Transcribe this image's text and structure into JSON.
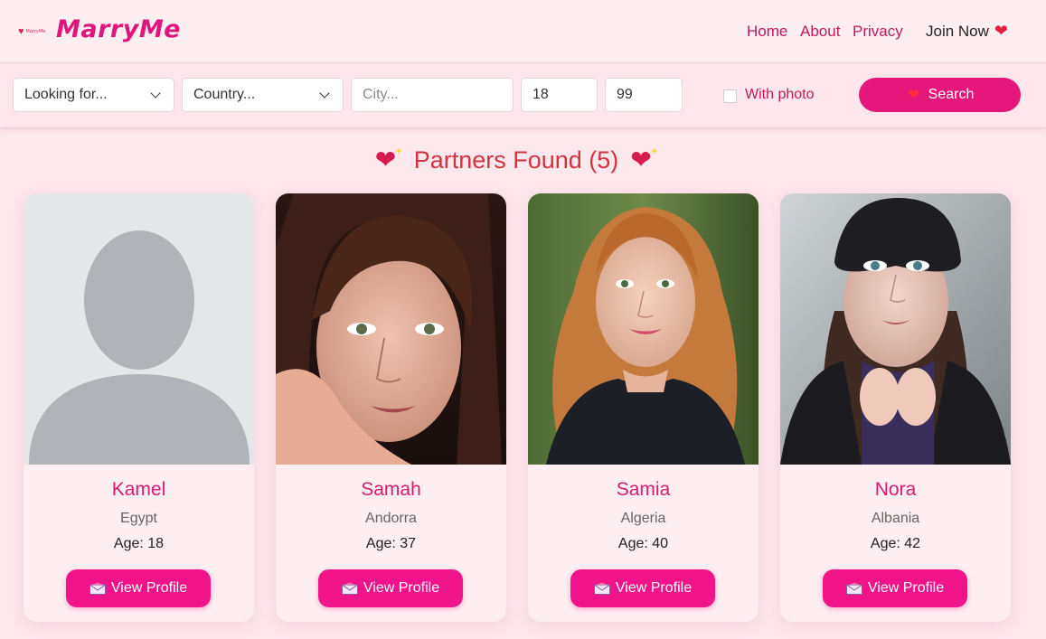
{
  "brand": {
    "name": "MarryMe",
    "mini_logo_text": "MarryMe",
    "color": "#e0157c"
  },
  "nav": {
    "home": "Home",
    "about": "About",
    "privacy": "Privacy",
    "join": "Join Now"
  },
  "filters": {
    "looking_for": "Looking for...",
    "country": "Country...",
    "city_placeholder": "City...",
    "age_min": "18",
    "age_max": "99",
    "with_photo_label": "With photo",
    "with_photo_checked": false,
    "search_label": "Search"
  },
  "results": {
    "title": "Partners Found (5)"
  },
  "profiles": [
    {
      "name": "Kamel",
      "country": "Egypt",
      "age": "Age: 18",
      "button": "View Profile",
      "photo": "default-avatar-icon"
    },
    {
      "name": "Samah",
      "country": "Andorra",
      "age": "Age: 37",
      "button": "View Profile",
      "photo": "portrait-photo"
    },
    {
      "name": "Samia",
      "country": "Algeria",
      "age": "Age: 40",
      "button": "View Profile",
      "photo": "portrait-photo"
    },
    {
      "name": "Nora",
      "country": "Albania",
      "age": "Age: 42",
      "button": "View Profile",
      "photo": "portrait-photo"
    }
  ],
  "colors": {
    "accent": "#e6177a",
    "background": "#fde8ee",
    "name_color": "#d81b72",
    "title_color": "#d2343f"
  }
}
